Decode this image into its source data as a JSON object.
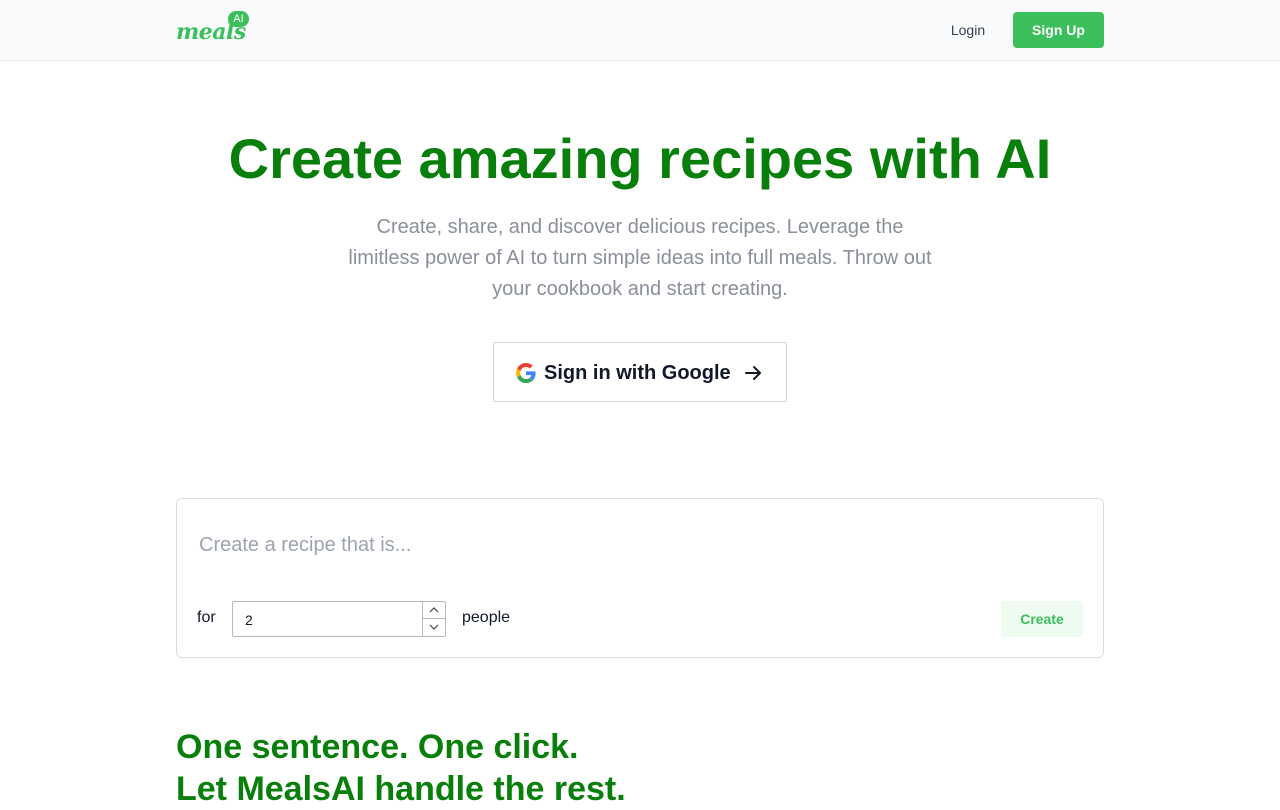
{
  "header": {
    "logo_text": "meals",
    "logo_badge": "AI",
    "login_label": "Login",
    "signup_label": "Sign Up"
  },
  "hero": {
    "title": "Create amazing recipes with AI",
    "subtitle": "Create, share, and discover delicious recipes. Leverage the limitless power of AI to turn simple ideas into full meals. Throw out your cookbook and start creating.",
    "google_button_label": "Sign in with Google"
  },
  "recipe_form": {
    "prompt_placeholder": "Create a recipe that is...",
    "for_label": "for",
    "servings_value": "2",
    "people_label": "people",
    "create_label": "Create"
  },
  "tagline": {
    "line1": "One sentence. One click.",
    "line2": "Let MealsAI handle the rest."
  },
  "colors": {
    "brand_green": "#3bbf5a",
    "headline_green": "#087f0a",
    "muted_text": "#8a8f99"
  },
  "icons": {
    "google": "google-g-icon",
    "arrow": "arrow-right-icon",
    "stepper_up": "chevron-up-icon",
    "stepper_down": "chevron-down-icon"
  }
}
